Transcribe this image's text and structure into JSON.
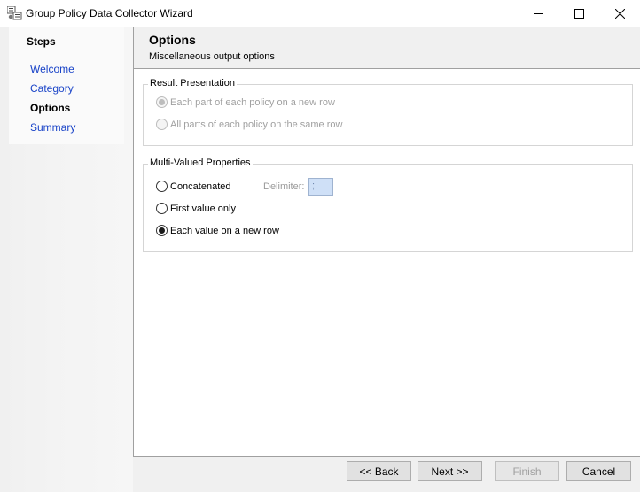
{
  "window": {
    "title": "Group Policy Data Collector Wizard"
  },
  "steps": {
    "title": "Steps",
    "items": [
      {
        "label": "Welcome"
      },
      {
        "label": "Category"
      },
      {
        "label": "Options"
      },
      {
        "label": "Summary"
      }
    ]
  },
  "header": {
    "title": "Options",
    "subtitle": "Miscellaneous output options"
  },
  "result_presentation": {
    "legend": "Result Presentation",
    "options": [
      {
        "label": "Each part of each policy on a new row"
      },
      {
        "label": "All parts of each policy on the same row"
      }
    ]
  },
  "multi_valued": {
    "legend": "Multi-Valued Properties",
    "options": [
      {
        "label": "Concatenated"
      },
      {
        "label": "First value only"
      },
      {
        "label": "Each value on a new row"
      }
    ],
    "delimiter_label": "Delimiter:",
    "delimiter_value": ";"
  },
  "buttons": {
    "back": "<< Back",
    "next": "Next >>",
    "finish": "Finish",
    "cancel": "Cancel"
  }
}
